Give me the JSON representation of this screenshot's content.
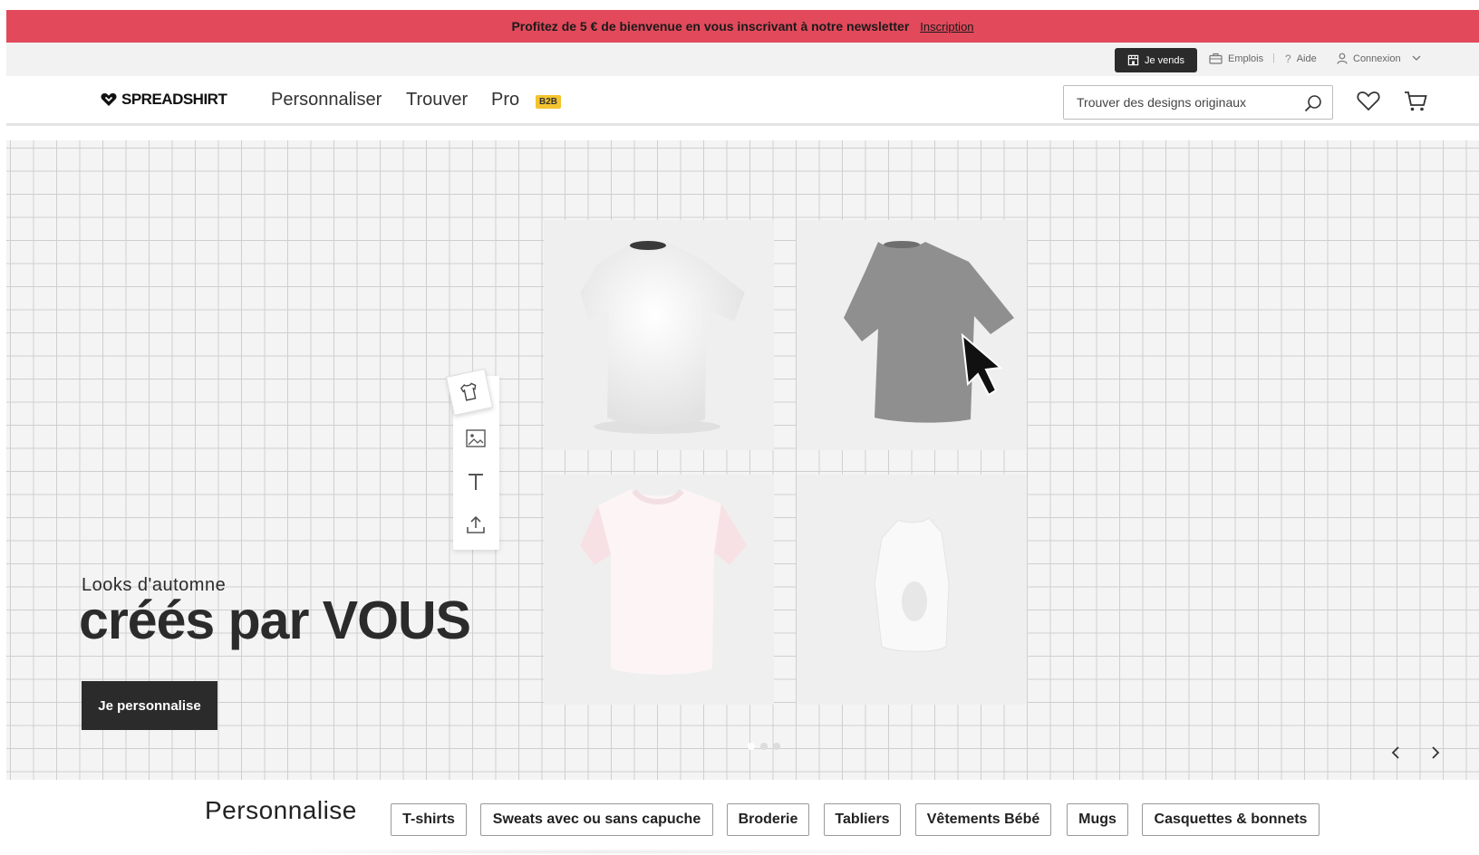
{
  "promo": {
    "text": "Profitez de 5 € de bienvenue en vous inscrivant à notre newsletter",
    "link": "Inscription"
  },
  "utility_bar": {
    "sell_label": "Je vends",
    "jobs_label": "Emplois",
    "help_label": "Aide",
    "login_label": "Connexion"
  },
  "nav": {
    "logo_text": "SPREADSHIRT",
    "items": [
      {
        "label": "Personnaliser"
      },
      {
        "label": "Trouver"
      },
      {
        "label": "Pro"
      }
    ],
    "pro_badge": "B2B",
    "search_placeholder": "Trouver des designs originaux"
  },
  "hero": {
    "kicker": "Looks d'automne",
    "title": "créés par VOUS",
    "cta_label": "Je personnalise",
    "tools": [
      "shirt-icon",
      "image-icon",
      "text-icon",
      "upload-icon"
    ],
    "products": [
      {
        "name": "white-tshirt",
        "color": "#ffffff"
      },
      {
        "name": "grey-tshirt",
        "color": "#8f8f8f"
      },
      {
        "name": "pink-tshirt",
        "color": "#fbeff0"
      },
      {
        "name": "crop-top",
        "color": "#f7f7f7"
      }
    ],
    "slide_count": 3
  },
  "categories": {
    "title": "Personnalise",
    "items": [
      {
        "label": "T-shirts"
      },
      {
        "label": "Sweats avec ou sans capuche"
      },
      {
        "label": "Broderie"
      },
      {
        "label": "Tabliers"
      },
      {
        "label": "Vêtements Bébé"
      },
      {
        "label": "Mugs"
      },
      {
        "label": "Casquettes & bonnets"
      }
    ]
  },
  "colors": {
    "promo_bg": "#e2495b",
    "dark": "#2b2b2b",
    "badge": "#f4c430"
  }
}
